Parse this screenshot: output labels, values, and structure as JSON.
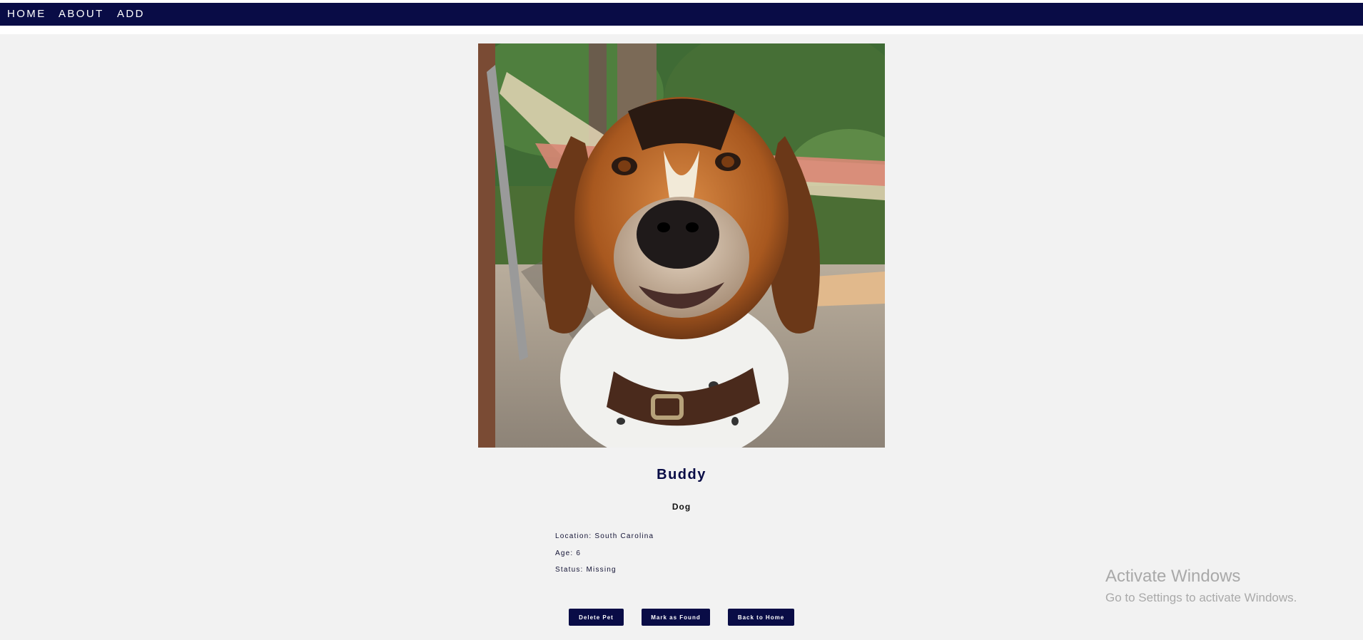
{
  "nav": {
    "items": [
      {
        "label": "HOME"
      },
      {
        "label": "ABOUT"
      },
      {
        "label": "ADD"
      }
    ],
    "bg_color": "#090c46"
  },
  "pet": {
    "name": "Buddy",
    "type": "Dog",
    "details": [
      {
        "text": "Location: South Carolina"
      },
      {
        "text": "Age: 6"
      },
      {
        "text": "Status: Missing"
      }
    ]
  },
  "actions": {
    "delete_label": "Delete Pet",
    "found_label": "Mark as Found",
    "home_label": "Back to Home"
  },
  "watermark": {
    "title": "Activate Windows",
    "subtitle": "Go to Settings to activate Windows."
  }
}
